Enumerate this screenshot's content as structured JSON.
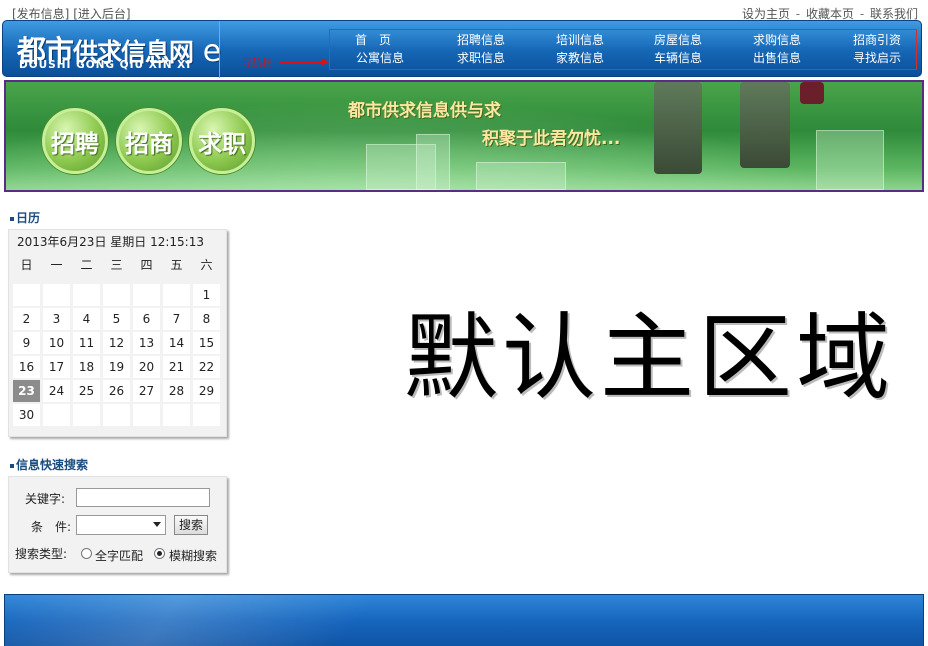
{
  "topbar": {
    "left": [
      "[发布信息]",
      "[进入后台]"
    ],
    "right": [
      "设为主页",
      "收藏本页",
      "联系我们"
    ],
    "right_sep": "-"
  },
  "header": {
    "logo_cn_big": "都市",
    "logo_cn_rest": "供求信息网",
    "logo_suffix": "e",
    "logo_en": "DOUSHI  GONG QIU XIN XI",
    "arrow_note": "导航栏",
    "nav_row1": [
      "首　页",
      "招聘信息",
      "培训信息",
      "房屋信息",
      "求购信息",
      "招商引资"
    ],
    "nav_row2": [
      "公寓信息",
      "求职信息",
      "家教信息",
      "车辆信息",
      "出售信息",
      "寻找启示"
    ]
  },
  "banner": {
    "buttons": [
      "招聘",
      "招商",
      "求职"
    ],
    "slogan1": "都市供求信息供与求",
    "slogan2": "积聚于此君勿忧..."
  },
  "calendar": {
    "title": "日历",
    "header_text": "2013年6月23日  星期日   12:15:13",
    "weekdays": [
      "日",
      "一",
      "二",
      "三",
      "四",
      "五",
      "六"
    ],
    "rows": [
      [
        "",
        "",
        "",
        "",
        "",
        "",
        "1"
      ],
      [
        "2",
        "3",
        "4",
        "5",
        "6",
        "7",
        "8"
      ],
      [
        "9",
        "10",
        "11",
        "12",
        "13",
        "14",
        "15"
      ],
      [
        "16",
        "17",
        "18",
        "19",
        "20",
        "21",
        "22"
      ],
      [
        "23",
        "24",
        "25",
        "26",
        "27",
        "28",
        "29"
      ],
      [
        "30",
        "",
        "",
        "",
        "",
        "",
        ""
      ]
    ],
    "today": "23"
  },
  "search": {
    "title": "信息快速搜索",
    "keyword_label": "关键字:",
    "keyword_value": "",
    "condition_label": "条　件:",
    "condition_value": "",
    "button": "搜索",
    "type_label": "搜索类型:",
    "type_options": [
      "全字匹配",
      "模糊搜索"
    ],
    "type_selected": "模糊搜索"
  },
  "main": {
    "placeholder_text": "默认主区域"
  }
}
